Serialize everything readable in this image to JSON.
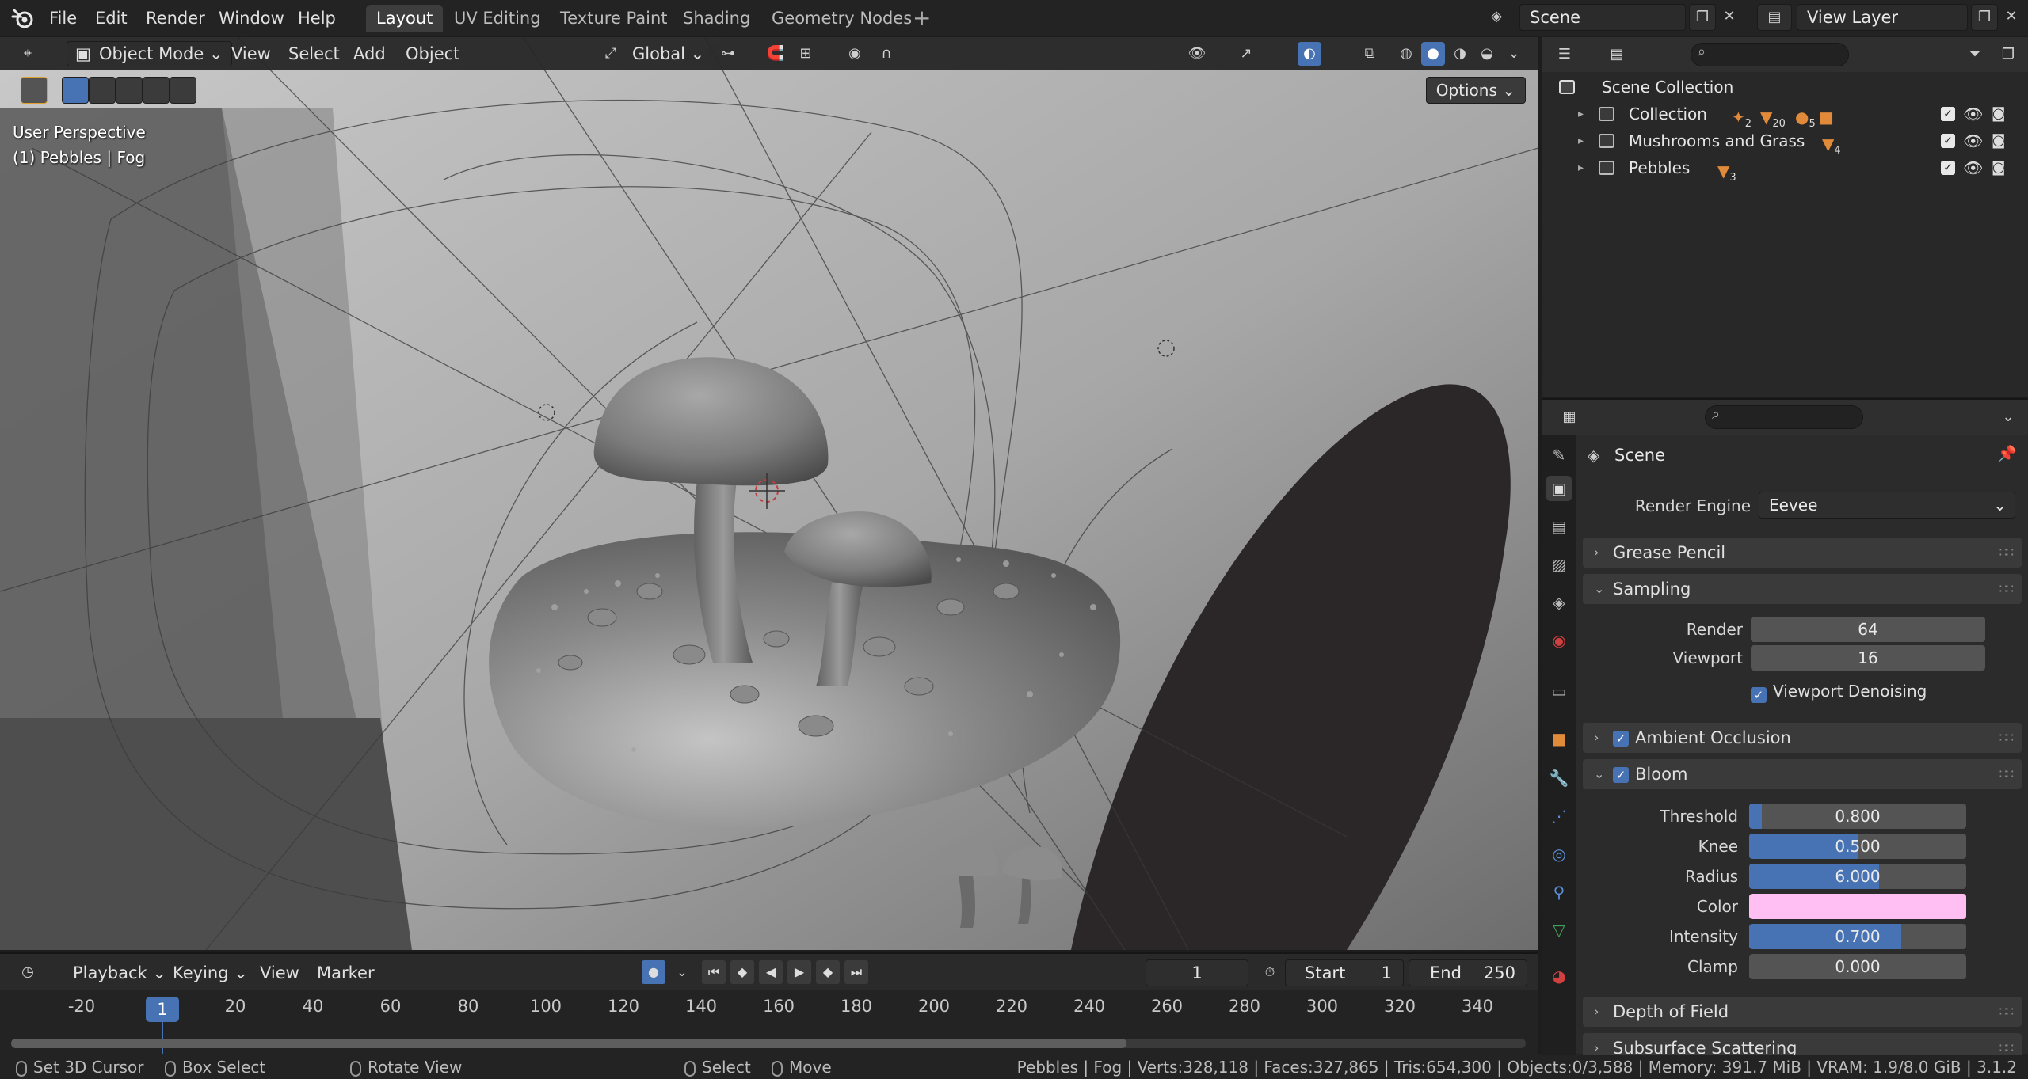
{
  "topbar": {
    "menus": [
      "File",
      "Edit",
      "Render",
      "Window",
      "Help"
    ],
    "workspaces": [
      "Layout",
      "UV Editing",
      "Texture Paint",
      "Shading",
      "Geometry Nodes"
    ],
    "active_workspace": "Layout",
    "scene_name": "Scene",
    "view_layer": "View Layer"
  },
  "viewport": {
    "mode": "Object Mode",
    "menus": [
      "View",
      "Select",
      "Add",
      "Object"
    ],
    "transform_orientation": "Global",
    "options_label": "Options",
    "overlay_text_1": "User Perspective",
    "overlay_text_2": "(1) Pebbles | Fog"
  },
  "timeline": {
    "menus": [
      "Playback",
      "Keying",
      "View",
      "Marker"
    ],
    "current_frame": "1",
    "start_label": "Start",
    "start_value": "1",
    "end_label": "End",
    "end_value": "250",
    "ruler_ticks": [
      "-20",
      "20",
      "40",
      "60",
      "80",
      "100",
      "120",
      "140",
      "160",
      "180",
      "200",
      "220",
      "240",
      "260",
      "280",
      "300",
      "320",
      "340"
    ],
    "marker_frame": "1"
  },
  "statusbar": {
    "items": [
      "Set 3D Cursor",
      "Box Select",
      "Rotate View",
      "Select",
      "Move"
    ],
    "stats": "Pebbles | Fog | Verts:328,118 | Faces:327,865 | Tris:654,300 | Objects:0/3,588 | Memory: 391.7 MiB | VRAM: 1.9/8.0 GiB | 3.1.2"
  },
  "outliner": {
    "root": "Scene Collection",
    "rows": [
      {
        "label": "Collection",
        "badges": [
          "2",
          "20",
          "5"
        ]
      },
      {
        "label": "Mushrooms and Grass",
        "badges": [
          "4"
        ]
      },
      {
        "label": "Pebbles",
        "badges": [
          "3"
        ]
      }
    ]
  },
  "properties": {
    "context": "Scene",
    "render_engine_label": "Render Engine",
    "render_engine": "Eevee",
    "panels": {
      "grease_pencil": "Grease Pencil",
      "sampling": "Sampling",
      "ambient_occlusion": "Ambient Occlusion",
      "bloom": "Bloom",
      "depth_of_field": "Depth of Field",
      "subsurface": "Subsurface Scattering"
    },
    "sampling": {
      "render_label": "Render",
      "render_value": "64",
      "viewport_label": "Viewport",
      "viewport_value": "16",
      "denoise_label": "Viewport Denoising"
    },
    "bloom": {
      "threshold_label": "Threshold",
      "threshold": "0.800",
      "threshold_fill": 0.06,
      "knee_label": "Knee",
      "knee": "0.500",
      "knee_fill": 0.5,
      "radius_label": "Radius",
      "radius": "6.000",
      "radius_fill": 0.6,
      "color_label": "Color",
      "color": "#ffbff2",
      "intensity_label": "Intensity",
      "intensity": "0.700",
      "intensity_fill": 0.7,
      "clamp_label": "Clamp",
      "clamp": "0.000",
      "clamp_fill": 0.0
    }
  },
  "colors": {
    "accent": "#4772b3",
    "panel_bg": "#2b2b2b",
    "orange_icon": "#e08a3a"
  }
}
